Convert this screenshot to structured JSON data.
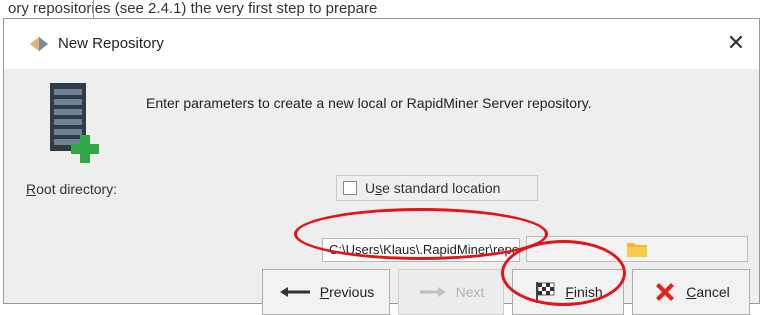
{
  "background": {
    "caption": "ory repositories (see 2.4.1) the very first step to prepare"
  },
  "dialog": {
    "title": "New Repository",
    "close_glyph": "✕",
    "instruction": "Enter parameters to create a new local or RapidMiner Server repository.",
    "root_directory": {
      "label_mnemonic": "R",
      "label_rest": "oot directory:"
    },
    "standard_location": {
      "checked": false,
      "label_prefix": "U",
      "label_mnemonic": "s",
      "label_rest": "e standard location"
    },
    "path_value": "C:\\Users\\Klaus\\.RapidMiner\\repositories\\Local Repository"
  },
  "buttons": {
    "previous": {
      "mnemonic": "P",
      "rest": "revious",
      "icon": "arrow-left-icon"
    },
    "next": {
      "label": "Next",
      "enabled": false,
      "icon": "arrow-right-icon"
    },
    "finish": {
      "mnemonic": "F",
      "rest": "inish",
      "icon": "checkered-flag-icon"
    },
    "cancel": {
      "mnemonic": "C",
      "rest": "ancel",
      "icon": "red-x-icon"
    }
  },
  "annotation_color": "#e3141b"
}
